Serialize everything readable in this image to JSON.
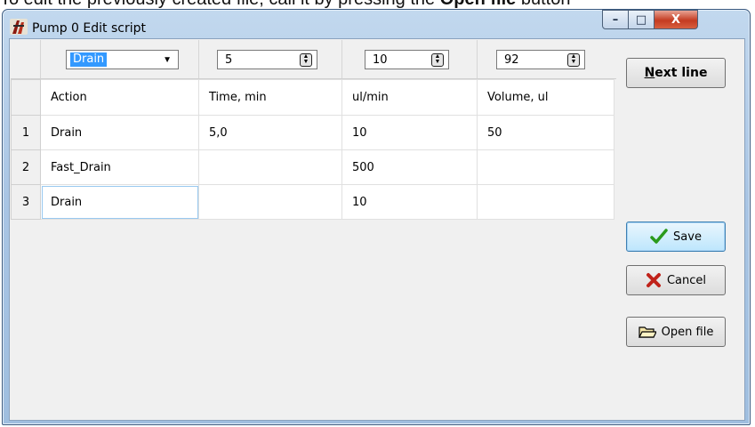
{
  "background_text": {
    "prefix": "To edit the previously created file, call it by pressing the ",
    "bold": "Open file",
    "suffix": " button"
  },
  "window": {
    "title": "Pump 0  Edit script"
  },
  "title_controls": {
    "minimize": "–",
    "maximize": "□",
    "close": "X"
  },
  "toolbar": {
    "action": "Drain",
    "time": "5",
    "rate": "10",
    "volume": "92"
  },
  "table": {
    "headers": [
      "Action",
      "Time, min",
      "ul/min",
      "Volume, ul"
    ],
    "rows": [
      {
        "num": "1",
        "cells": [
          "Drain",
          "5,0",
          "10",
          "50"
        ]
      },
      {
        "num": "2",
        "cells": [
          "Fast_Drain",
          "",
          "500",
          ""
        ]
      },
      {
        "num": "3",
        "cells": [
          "Drain",
          "",
          "10",
          ""
        ]
      }
    ]
  },
  "buttons": {
    "next_line_accel": "N",
    "next_line_rest": "ext line",
    "save": "Save",
    "cancel": "Cancel",
    "open_file": "Open file"
  },
  "icons": {
    "save": "check-icon",
    "cancel": "x-icon",
    "open_file": "folder-icon"
  },
  "colors": {
    "selection": "#3399ff",
    "check": "#2a9a1c",
    "cancel_x": "#c0221a",
    "title_close": "#c43b21"
  }
}
